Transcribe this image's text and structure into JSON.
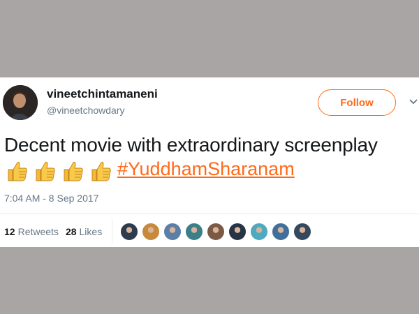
{
  "user": {
    "display_name": "vineetchintamaneni",
    "handle": "@vineetchowdary"
  },
  "follow_button": {
    "label": "Follow"
  },
  "tweet": {
    "text": "Decent movie with extraordinary screenplay",
    "emoji": [
      "thumbs-up",
      "thumbs-up",
      "thumbs-up",
      "thumbs-up"
    ],
    "hashtag": "#YuddhamSharanam",
    "timestamp": "7:04 AM - 8 Sep 2017"
  },
  "stats": {
    "retweets_count": "12",
    "retweets_label": "Retweets",
    "likes_count": "28",
    "likes_label": "Likes"
  },
  "likers": [
    {
      "color": "#2d3b4f"
    },
    {
      "color": "#c7893a"
    },
    {
      "color": "#5b7fa6"
    },
    {
      "color": "#3c7f8a"
    },
    {
      "color": "#7a5a44"
    },
    {
      "color": "#263445"
    },
    {
      "color": "#4fa9c0"
    },
    {
      "color": "#3f6f9a"
    },
    {
      "color": "#34495e"
    }
  ],
  "colors": {
    "accent": "#ff6a1a",
    "background": "#aaa5a5"
  }
}
